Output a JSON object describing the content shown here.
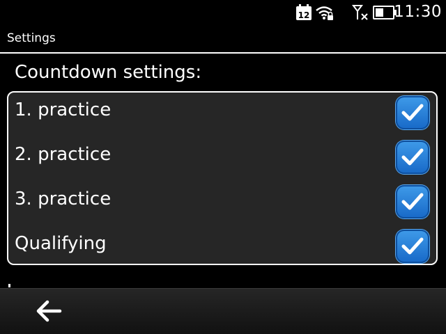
{
  "status_bar": {
    "calendar_day": "12",
    "time": "11:30",
    "icons": [
      "calendar-icon",
      "wifi-secure-icon",
      "no-signal-icon",
      "battery-icon"
    ]
  },
  "header": {
    "title": "Settings"
  },
  "section": {
    "heading": "Countdown settings:"
  },
  "settings_list": {
    "items": [
      {
        "label": "1. practice",
        "checked": true
      },
      {
        "label": "2. practice",
        "checked": true
      },
      {
        "label": "3. practice",
        "checked": true
      },
      {
        "label": "Qualifying",
        "checked": true
      }
    ]
  },
  "toolbar": {
    "back_icon": "back-arrow-icon"
  },
  "colors": {
    "background": "#000000",
    "list_background": "#262626",
    "checkbox_blue": "#2f86dd",
    "text": "#ffffff"
  }
}
